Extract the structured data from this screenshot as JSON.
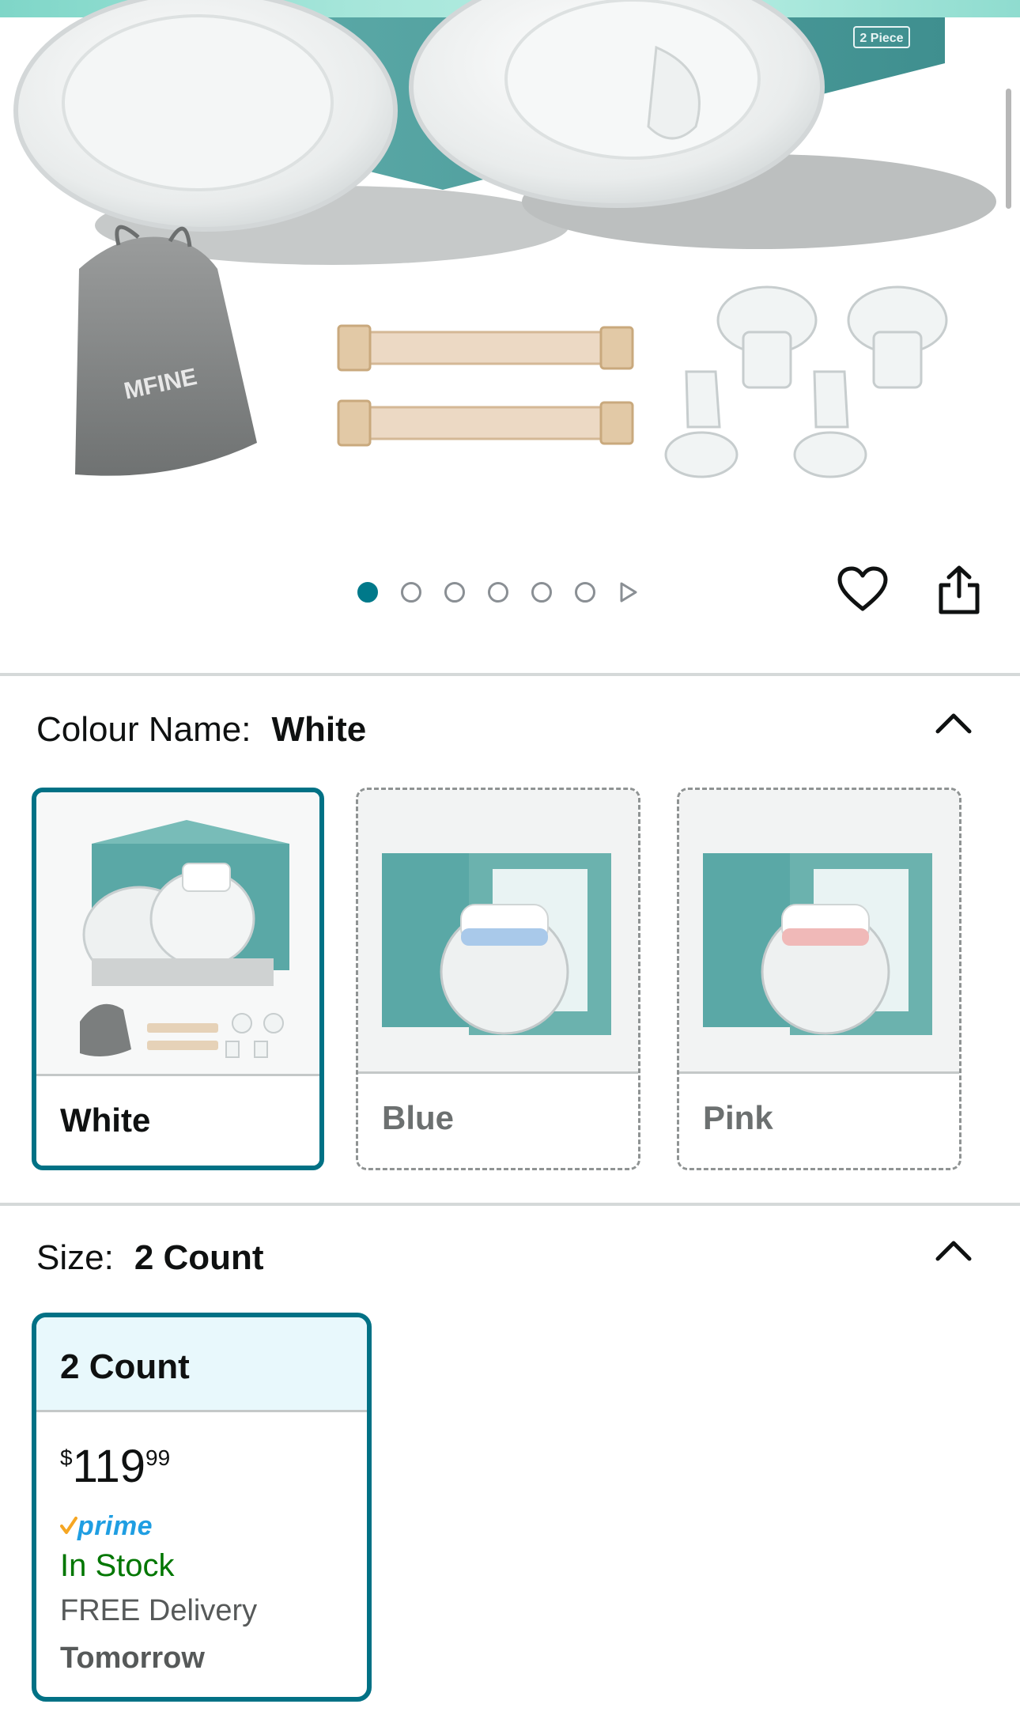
{
  "hero": {
    "box_badge": "2 Piece",
    "brand_logo_text": "MFINE",
    "image_count": 6,
    "active_image_index": 0,
    "accent_color": "#00798a"
  },
  "actions": {
    "wishlist_icon": "heart-icon",
    "share_icon": "share-icon"
  },
  "colour": {
    "label": "Colour Name:",
    "selected": "White",
    "options": [
      {
        "name": "White",
        "available": true,
        "selected": true,
        "accent": "#ffffff"
      },
      {
        "name": "Blue",
        "available": false,
        "selected": false,
        "accent": "#a9c9ea"
      },
      {
        "name": "Pink",
        "available": false,
        "selected": false,
        "accent": "#f0b9b8"
      }
    ]
  },
  "size": {
    "label": "Size:",
    "selected": "2 Count",
    "options": [
      {
        "name": "2 Count",
        "price_symbol": "$",
        "price_whole": "119",
        "price_fraction": "99",
        "prime_label": "prime",
        "stock": "In Stock",
        "delivery": "FREE Delivery",
        "delivery_day": "Tomorrow"
      }
    ]
  },
  "colors": {
    "selected_border": "#007185",
    "in_stock": "#007600",
    "prime_blue": "#1f9ee2",
    "prime_check": "#f5a623"
  }
}
